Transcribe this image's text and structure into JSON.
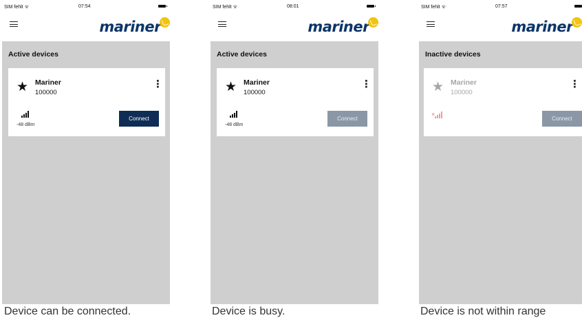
{
  "screens": [
    {
      "status_left": "SIM fehlt ᯤ",
      "time": "07:54",
      "brand": "mariner",
      "section_title": "Active devices",
      "device": {
        "name": "Mariner",
        "id": "100000",
        "signal": "-48 dBm"
      },
      "connect_label": "Connect",
      "button_state": "enabled",
      "caption": "Device can be connected."
    },
    {
      "status_left": "SIM fehlt ᯤ",
      "time": "08:01",
      "brand": "mariner",
      "section_title": "Active devices",
      "device": {
        "name": "Mariner",
        "id": "100000",
        "signal": "-48 dBm"
      },
      "connect_label": "Connect",
      "button_state": "busy",
      "caption": "Device is busy."
    },
    {
      "status_left": "SIM fehlt ᯤ",
      "time": "07:57",
      "brand": "mariner",
      "section_title": "Inactive devices",
      "device": {
        "name": "Mariner",
        "id": "100000",
        "signal": ""
      },
      "connect_label": "Connect",
      "button_state": "disabled",
      "caption": "Device is not within range"
    }
  ],
  "colors": {
    "brand": "#0b3569",
    "button_active": "#0f2d55",
    "button_disabled": "#8b97a6",
    "content_bg": "#cfcfcf",
    "sun": "#f1c40f"
  },
  "icons": [
    "menu-icon",
    "star-icon",
    "more-vertical-icon",
    "signal-icon",
    "no-signal-icon",
    "battery-icon",
    "wifi-icon"
  ]
}
